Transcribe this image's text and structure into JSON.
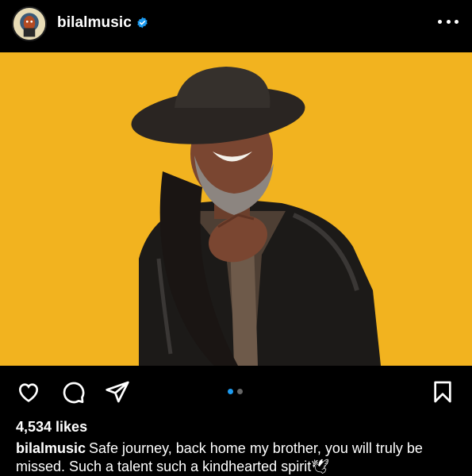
{
  "post": {
    "username": "bilalmusic",
    "verified": true,
    "likes": "4,534 likes",
    "caption_user": "bilalmusic",
    "caption_text": "Safe journey, back home my brother, you will truly be missed. Such a talent such a kindhearted spirit",
    "caption_emoji": "🕊",
    "carousel": {
      "count": 2,
      "active_index": 0
    }
  },
  "icons": {
    "more": "more-options-icon",
    "like": "heart-icon",
    "comment": "comment-icon",
    "share": "send-icon",
    "save": "bookmark-icon",
    "verified": "verified-badge-icon"
  },
  "colors": {
    "background": "#000000",
    "photo_background": "#f2b31f",
    "verified_blue": "#1d9bf0",
    "carousel_active": "#1d9bf0",
    "carousel_inactive": "#666666"
  }
}
